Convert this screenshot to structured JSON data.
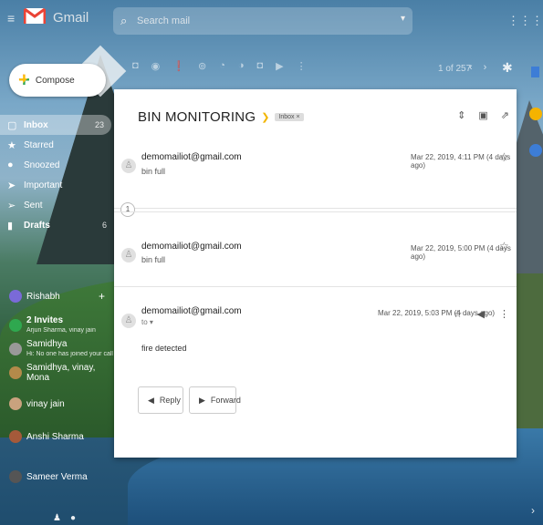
{
  "app": {
    "title": "Gmail"
  },
  "search": {
    "placeholder": "Search mail"
  },
  "compose": {
    "label": "Compose"
  },
  "sidebar": {
    "items": [
      {
        "label": "Inbox",
        "count": "23",
        "icon": "inbox-icon"
      },
      {
        "label": "Starred",
        "count": "",
        "icon": "star-icon"
      },
      {
        "label": "Snoozed",
        "count": "",
        "icon": "clock-icon"
      },
      {
        "label": "Important",
        "count": "",
        "icon": "important-icon"
      },
      {
        "label": "Sent",
        "count": "",
        "icon": "send-icon"
      },
      {
        "label": "Drafts",
        "count": "6",
        "icon": "draft-icon"
      }
    ]
  },
  "contacts": {
    "items": [
      {
        "name": "Rishabh",
        "sub": ""
      },
      {
        "name": "2 Invites",
        "sub": "Arjun Sharma, vinay jain"
      },
      {
        "name": "Samidhya",
        "sub": "Hi: No one has joined your call"
      },
      {
        "name": "Samidhya, vinay, Mona",
        "sub": ""
      },
      {
        "name": "vinay jain",
        "sub": ""
      },
      {
        "name": "Anshi Sharma",
        "sub": ""
      },
      {
        "name": "Sameer Verma",
        "sub": ""
      }
    ]
  },
  "toolbar": {
    "pager": "1 of 257"
  },
  "thread": {
    "subject": "BIN MONITORING",
    "label": "Inbox ×",
    "messages": [
      {
        "from": "demomailiot@gmail.com",
        "snippet": "bin full",
        "date": "Mar 22, 2019, 4:11 PM (4 days ago)"
      },
      {
        "from": "demomailiot@gmail.com",
        "snippet": "bin full",
        "date": "Mar 22, 2019, 5:00 PM (4 days ago)"
      },
      {
        "from": "demomailiot@gmail.com",
        "to": "to ▾",
        "body": "fire detected",
        "date": "Mar 22, 2019, 5:03 PM (4 days ago)"
      }
    ],
    "collapsed_count": "1",
    "reply_label": "Reply",
    "forward_label": "Forward"
  },
  "colors": {
    "gmail_red": "#EA4335",
    "important_yellow": "#F2B500",
    "accent_blue": "#3D7DD6"
  }
}
